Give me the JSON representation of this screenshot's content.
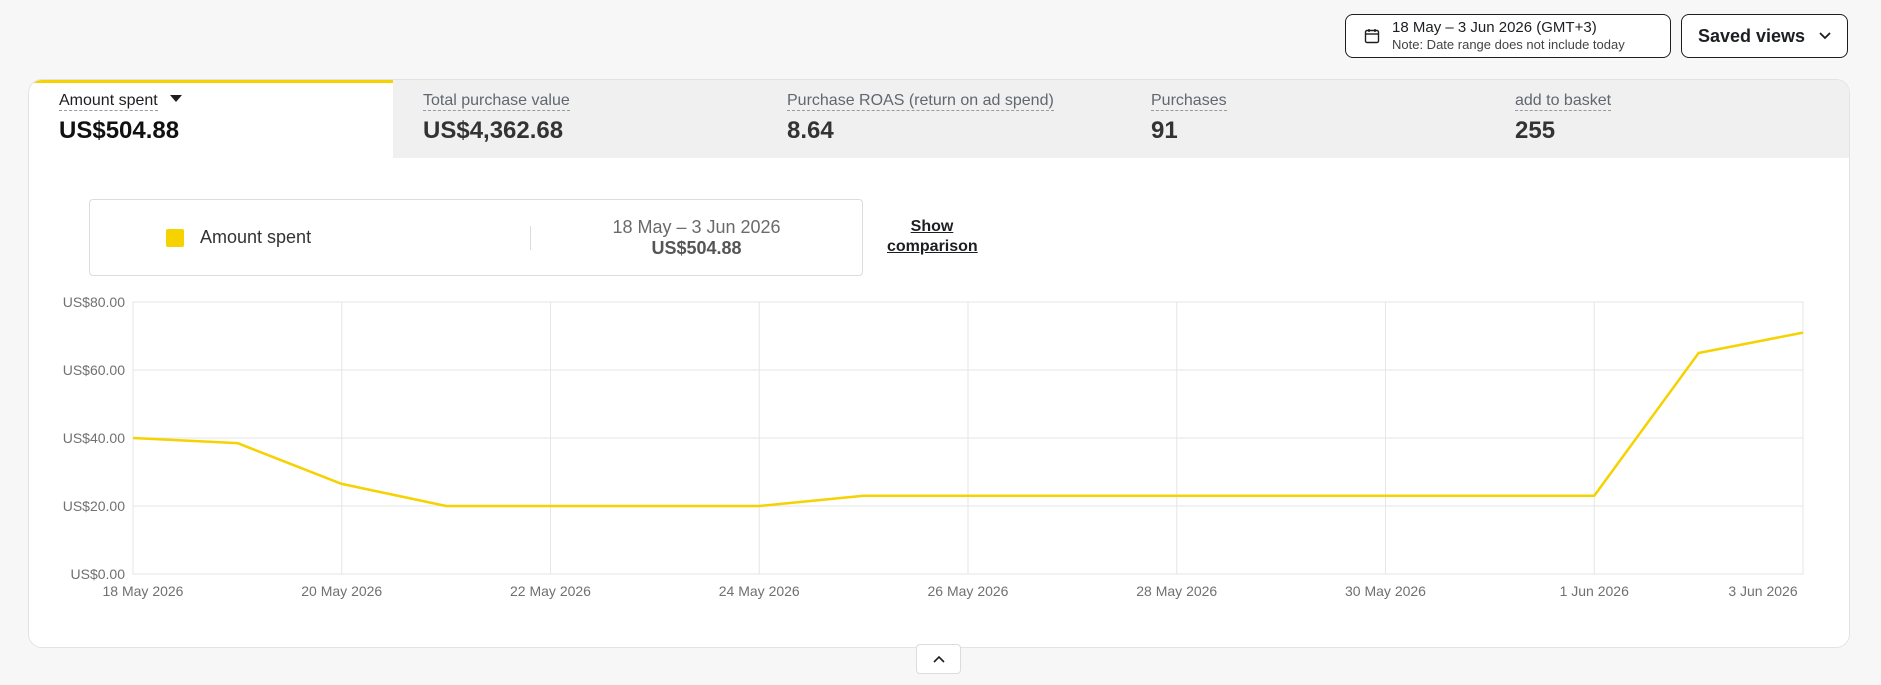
{
  "header": {
    "date_range": "18 May – 3 Jun 2026 (GMT+3)",
    "date_note": "Note: Date range does not include today",
    "saved_views": "Saved views"
  },
  "metrics": [
    {
      "label": "Amount spent",
      "value": "US$504.88",
      "active": true
    },
    {
      "label": "Total purchase value",
      "value": "US$4,362.68",
      "active": false
    },
    {
      "label": "Purchase ROAS (return on ad spend)",
      "value": "8.64",
      "active": false
    },
    {
      "label": "Purchases",
      "value": "91",
      "active": false
    },
    {
      "label": "add to basket",
      "value": "255",
      "active": false
    }
  ],
  "legend": {
    "series_name": "Amount spent",
    "date_range": "18 May – 3 Jun 2026",
    "total": "US$504.88",
    "show_comparison": "Show comparison"
  },
  "colors": {
    "accent": "#f5d200"
  },
  "chart_data": {
    "type": "line",
    "x": [
      "18 May 2026",
      "19 May 2026",
      "20 May 2026",
      "21 May 2026",
      "22 May 2026",
      "23 May 2026",
      "24 May 2026",
      "25 May 2026",
      "26 May 2026",
      "27 May 2026",
      "28 May 2026",
      "29 May 2026",
      "30 May 2026",
      "31 May 2026",
      "1 Jun 2026",
      "2 Jun 2026",
      "3 Jun 2026"
    ],
    "x_tick_labels": [
      "18 May 2026",
      "20 May 2026",
      "22 May 2026",
      "24 May 2026",
      "26 May 2026",
      "28 May 2026",
      "30 May 2026",
      "1 Jun 2026",
      "3 Jun 2026"
    ],
    "y_tick_labels": [
      "US$0.00",
      "US$20.00",
      "US$40.00",
      "US$60.00",
      "US$80.00"
    ],
    "y_ticks": [
      0,
      20,
      40,
      60,
      80
    ],
    "ylim": [
      0,
      80
    ],
    "series": [
      {
        "name": "Amount spent",
        "values": [
          40,
          38.5,
          26.5,
          20,
          20,
          20,
          20,
          23,
          23,
          23,
          23,
          23,
          23,
          23,
          23,
          65,
          71
        ]
      }
    ],
    "grid": true
  }
}
